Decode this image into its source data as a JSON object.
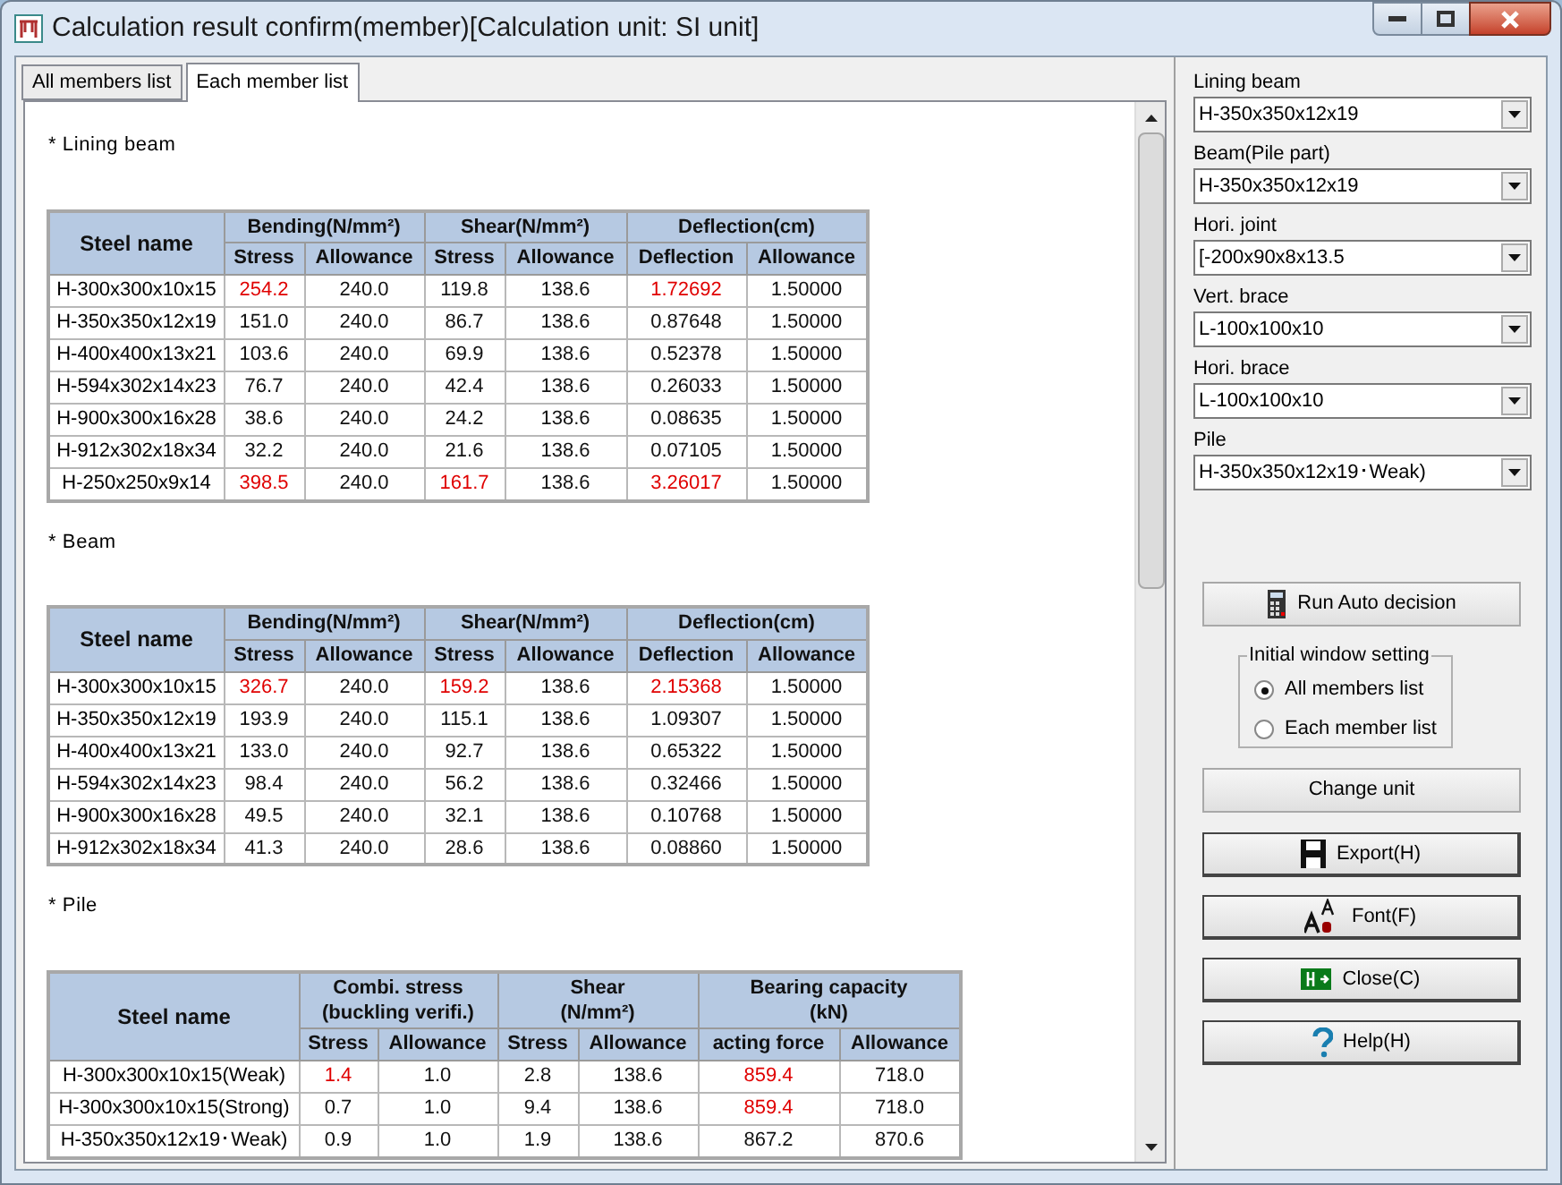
{
  "window": {
    "title": "Calculation result confirm(member)[Calculation unit: SI unit]"
  },
  "tabs": [
    {
      "label": "All members list",
      "selected": false
    },
    {
      "label": "Each member list",
      "selected": true
    }
  ],
  "sections": [
    {
      "heading": "* Lining beam",
      "table": {
        "corner": "Steel name",
        "groups": [
          {
            "label": "Bending(N/mm²)",
            "columns": [
              "Stress",
              "Allowance"
            ]
          },
          {
            "label": "Shear(N/mm²)",
            "columns": [
              "Stress",
              "Allowance"
            ]
          },
          {
            "label": "Deflection(cm)",
            "columns": [
              "Deflection",
              "Allowance"
            ]
          }
        ],
        "rows": [
          {
            "name": "H-300x300x10x15",
            "cells": [
              {
                "text": "254.2",
                "exceeded": true
              },
              {
                "text": "240.0",
                "exceeded": false
              },
              {
                "text": "119.8",
                "exceeded": false
              },
              {
                "text": "138.6",
                "exceeded": false
              },
              {
                "text": "1.72692",
                "exceeded": true
              },
              {
                "text": "1.50000",
                "exceeded": false
              }
            ]
          },
          {
            "name": "H-350x350x12x19",
            "cells": [
              {
                "text": "151.0",
                "exceeded": false
              },
              {
                "text": "240.0",
                "exceeded": false
              },
              {
                "text": "86.7",
                "exceeded": false
              },
              {
                "text": "138.6",
                "exceeded": false
              },
              {
                "text": "0.87648",
                "exceeded": false
              },
              {
                "text": "1.50000",
                "exceeded": false
              }
            ]
          },
          {
            "name": "H-400x400x13x21",
            "cells": [
              {
                "text": "103.6",
                "exceeded": false
              },
              {
                "text": "240.0",
                "exceeded": false
              },
              {
                "text": "69.9",
                "exceeded": false
              },
              {
                "text": "138.6",
                "exceeded": false
              },
              {
                "text": "0.52378",
                "exceeded": false
              },
              {
                "text": "1.50000",
                "exceeded": false
              }
            ]
          },
          {
            "name": "H-594x302x14x23",
            "cells": [
              {
                "text": "76.7",
                "exceeded": false
              },
              {
                "text": "240.0",
                "exceeded": false
              },
              {
                "text": "42.4",
                "exceeded": false
              },
              {
                "text": "138.6",
                "exceeded": false
              },
              {
                "text": "0.26033",
                "exceeded": false
              },
              {
                "text": "1.50000",
                "exceeded": false
              }
            ]
          },
          {
            "name": "H-900x300x16x28",
            "cells": [
              {
                "text": "38.6",
                "exceeded": false
              },
              {
                "text": "240.0",
                "exceeded": false
              },
              {
                "text": "24.2",
                "exceeded": false
              },
              {
                "text": "138.6",
                "exceeded": false
              },
              {
                "text": "0.08635",
                "exceeded": false
              },
              {
                "text": "1.50000",
                "exceeded": false
              }
            ]
          },
          {
            "name": "H-912x302x18x34",
            "cells": [
              {
                "text": "32.2",
                "exceeded": false
              },
              {
                "text": "240.0",
                "exceeded": false
              },
              {
                "text": "21.6",
                "exceeded": false
              },
              {
                "text": "138.6",
                "exceeded": false
              },
              {
                "text": "0.07105",
                "exceeded": false
              },
              {
                "text": "1.50000",
                "exceeded": false
              }
            ]
          },
          {
            "name": "H-250x250x9x14",
            "cells": [
              {
                "text": "398.5",
                "exceeded": true
              },
              {
                "text": "240.0",
                "exceeded": false
              },
              {
                "text": "161.7",
                "exceeded": true
              },
              {
                "text": "138.6",
                "exceeded": false
              },
              {
                "text": "3.26017",
                "exceeded": true
              },
              {
                "text": "1.50000",
                "exceeded": false
              }
            ]
          }
        ]
      }
    },
    {
      "heading": "* Beam",
      "table": {
        "corner": "Steel name",
        "groups": [
          {
            "label": "Bending(N/mm²)",
            "columns": [
              "Stress",
              "Allowance"
            ]
          },
          {
            "label": "Shear(N/mm²)",
            "columns": [
              "Stress",
              "Allowance"
            ]
          },
          {
            "label": "Deflection(cm)",
            "columns": [
              "Deflection",
              "Allowance"
            ]
          }
        ],
        "rows": [
          {
            "name": "H-300x300x10x15",
            "cells": [
              {
                "text": "326.7",
                "exceeded": true
              },
              {
                "text": "240.0",
                "exceeded": false
              },
              {
                "text": "159.2",
                "exceeded": true
              },
              {
                "text": "138.6",
                "exceeded": false
              },
              {
                "text": "2.15368",
                "exceeded": true
              },
              {
                "text": "1.50000",
                "exceeded": false
              }
            ]
          },
          {
            "name": "H-350x350x12x19",
            "cells": [
              {
                "text": "193.9",
                "exceeded": false
              },
              {
                "text": "240.0",
                "exceeded": false
              },
              {
                "text": "115.1",
                "exceeded": false
              },
              {
                "text": "138.6",
                "exceeded": false
              },
              {
                "text": "1.09307",
                "exceeded": false
              },
              {
                "text": "1.50000",
                "exceeded": false
              }
            ]
          },
          {
            "name": "H-400x400x13x21",
            "cells": [
              {
                "text": "133.0",
                "exceeded": false
              },
              {
                "text": "240.0",
                "exceeded": false
              },
              {
                "text": "92.7",
                "exceeded": false
              },
              {
                "text": "138.6",
                "exceeded": false
              },
              {
                "text": "0.65322",
                "exceeded": false
              },
              {
                "text": "1.50000",
                "exceeded": false
              }
            ]
          },
          {
            "name": "H-594x302x14x23",
            "cells": [
              {
                "text": "98.4",
                "exceeded": false
              },
              {
                "text": "240.0",
                "exceeded": false
              },
              {
                "text": "56.2",
                "exceeded": false
              },
              {
                "text": "138.6",
                "exceeded": false
              },
              {
                "text": "0.32466",
                "exceeded": false
              },
              {
                "text": "1.50000",
                "exceeded": false
              }
            ]
          },
          {
            "name": "H-900x300x16x28",
            "cells": [
              {
                "text": "49.5",
                "exceeded": false
              },
              {
                "text": "240.0",
                "exceeded": false
              },
              {
                "text": "32.1",
                "exceeded": false
              },
              {
                "text": "138.6",
                "exceeded": false
              },
              {
                "text": "0.10768",
                "exceeded": false
              },
              {
                "text": "1.50000",
                "exceeded": false
              }
            ]
          },
          {
            "name": "H-912x302x18x34",
            "cells": [
              {
                "text": "41.3",
                "exceeded": false
              },
              {
                "text": "240.0",
                "exceeded": false
              },
              {
                "text": "28.6",
                "exceeded": false
              },
              {
                "text": "138.6",
                "exceeded": false
              },
              {
                "text": "0.08860",
                "exceeded": false
              },
              {
                "text": "1.50000",
                "exceeded": false
              }
            ]
          }
        ]
      }
    },
    {
      "heading": "* Pile",
      "table": {
        "corner": "Steel name",
        "groups": [
          {
            "label": "Combi. stress\n(buckling verifi.)",
            "columns": [
              "Stress",
              "Allowance"
            ]
          },
          {
            "label": "Shear\n(N/mm²)",
            "columns": [
              "Stress",
              "Allowance"
            ]
          },
          {
            "label": "Bearing capacity\n(kN)",
            "columns": [
              "acting force",
              "Allowance"
            ]
          }
        ],
        "rows": [
          {
            "name": "H-300x300x10x15(Weak)",
            "cells": [
              {
                "text": "1.4",
                "exceeded": true
              },
              {
                "text": "1.0",
                "exceeded": false
              },
              {
                "text": "2.8",
                "exceeded": false
              },
              {
                "text": "138.6",
                "exceeded": false
              },
              {
                "text": "859.4",
                "exceeded": true
              },
              {
                "text": "718.0",
                "exceeded": false
              }
            ]
          },
          {
            "name": "H-300x300x10x15(Strong)",
            "cells": [
              {
                "text": "0.7",
                "exceeded": false
              },
              {
                "text": "1.0",
                "exceeded": false
              },
              {
                "text": "9.4",
                "exceeded": false
              },
              {
                "text": "138.6",
                "exceeded": false
              },
              {
                "text": "859.4",
                "exceeded": true
              },
              {
                "text": "718.0",
                "exceeded": false
              }
            ]
          },
          {
            "name": "H-350x350x12x19･Weak)",
            "cells": [
              {
                "text": "0.9",
                "exceeded": false
              },
              {
                "text": "1.0",
                "exceeded": false
              },
              {
                "text": "1.9",
                "exceeded": false
              },
              {
                "text": "138.6",
                "exceeded": false
              },
              {
                "text": "867.2",
                "exceeded": false
              },
              {
                "text": "870.6",
                "exceeded": false
              }
            ]
          }
        ]
      }
    }
  ],
  "selectors": [
    {
      "label": "Lining beam",
      "value": "H-350x350x12x19"
    },
    {
      "label": "Beam(Pile part)",
      "value": "H-350x350x12x19"
    },
    {
      "label": "Hori. joint",
      "value": "[-200x90x8x13.5"
    },
    {
      "label": "Vert. brace",
      "value": "L-100x100x10"
    },
    {
      "label": "Hori. brace",
      "value": "L-100x100x10"
    },
    {
      "label": "Pile",
      "value": "H-350x350x12x19･Weak)"
    }
  ],
  "auto_button": {
    "label": "Run Auto decision"
  },
  "initial_window_setting": {
    "legend": "Initial window setting",
    "options": [
      {
        "label": "All members list",
        "selected": true
      },
      {
        "label": "Each member list",
        "selected": false
      }
    ]
  },
  "buttons": [
    {
      "label": "Change unit",
      "kind": "plain"
    },
    {
      "label": "Export(H)",
      "kind": "export"
    },
    {
      "label": "Font(F)",
      "kind": "font"
    },
    {
      "label": "Close(C)",
      "kind": "close"
    },
    {
      "label": "Help(H)",
      "kind": "help"
    }
  ]
}
